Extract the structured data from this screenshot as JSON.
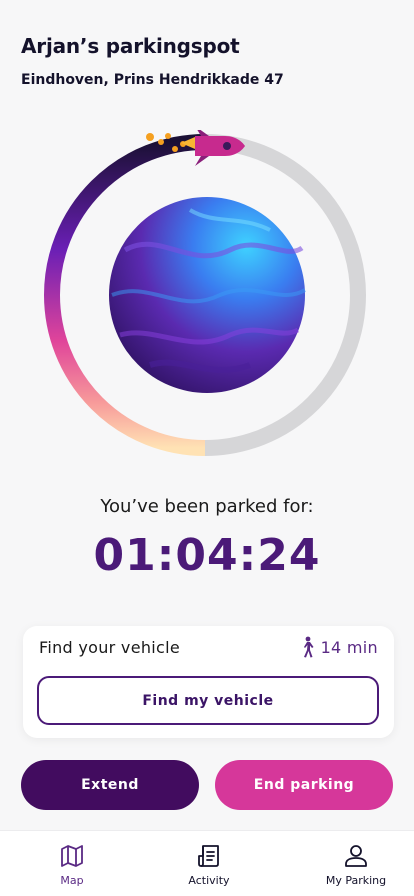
{
  "header": {
    "title": "Arjan’s parkingspot",
    "address": "Eindhoven, Prins Hendrikkade 47"
  },
  "status": {
    "parked_label": "You’ve been parked for:",
    "duration": "01:04:24",
    "progress_fraction": 0.5
  },
  "vehicle_card": {
    "title": "Find your vehicle",
    "walk_time": "14 min",
    "button_label": "Find my vehicle"
  },
  "actions": {
    "extend_label": "Extend",
    "end_label": "End parking"
  },
  "tabs": [
    {
      "label": "Map",
      "icon": "map-icon",
      "active": true
    },
    {
      "label": "Activity",
      "icon": "activity-icon",
      "active": false
    },
    {
      "label": "My Parking",
      "icon": "user-icon",
      "active": false
    }
  ],
  "colors": {
    "primary": "#420c5f",
    "accent": "#d6379a",
    "timer": "#4b1a78",
    "ring_track": "#d6d6d8"
  }
}
